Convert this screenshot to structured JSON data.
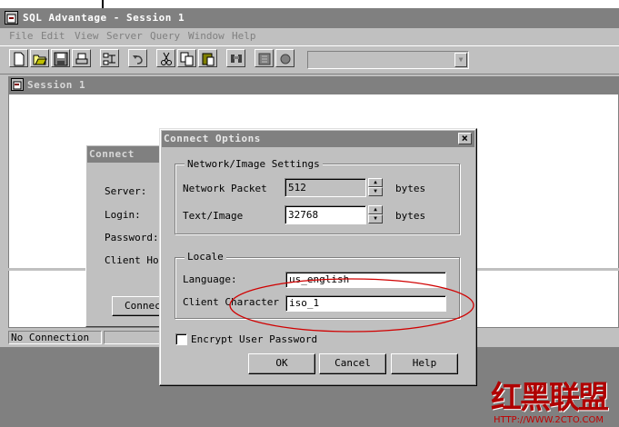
{
  "app": {
    "title": "SQL Advantage - Session 1"
  },
  "menu": [
    "File",
    "Edit",
    "View",
    "Server",
    "Query",
    "Window",
    "Help"
  ],
  "toolbar": {
    "icons": [
      "new-file-icon",
      "open-folder-icon",
      "save-icon",
      "print-icon",
      "connection-icon",
      "undo-icon",
      "cut-icon",
      "copy-icon",
      "paste-icon",
      "find-icon",
      "execute-icon",
      "stop-icon"
    ]
  },
  "session": {
    "title": "Session 1",
    "status": "No Connection"
  },
  "connect": {
    "title": "Connect",
    "server_label": "Server:",
    "login_label": "Login:",
    "password_label": "Password:",
    "client_host_label": "Client Hos",
    "connect_button": "Connec"
  },
  "options": {
    "title": "Connect Options",
    "close": "×",
    "network_group": "Network/Image Settings",
    "packet_label": "Network Packet",
    "packet_value": "512",
    "packet_unit": "bytes",
    "textimage_label": "Text/Image",
    "textimage_value": "32768",
    "textimage_unit": "bytes",
    "locale_group": "Locale",
    "language_label": "Language:",
    "language_value": "us_english",
    "charset_label": "Client Character",
    "charset_value": "iso_1",
    "encrypt_label": "Encrypt User Password",
    "ok": "OK",
    "cancel": "Cancel",
    "help": "Help"
  },
  "watermark": {
    "text": "红黑联盟",
    "url": "HTTP://WWW.2CTO.COM"
  }
}
